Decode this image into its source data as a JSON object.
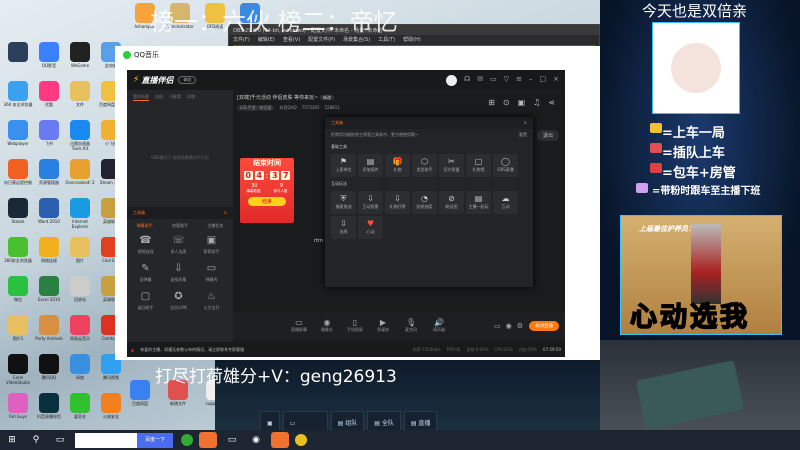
{
  "desktop": {
    "icons": [
      [
        "Ashampoo",
        "#f7a23a"
      ],
      [
        "Administrator",
        "#d7b56a"
      ],
      [
        "OFD阅读",
        "#f0c040"
      ],
      [
        "OFD",
        "#3a8be0"
      ],
      [
        "",
        "#2c3f5a"
      ],
      [
        "QQ影音",
        "#3a80ff"
      ],
      [
        "WeGame",
        "#222"
      ],
      [
        "此电脑",
        "#5aa0e8"
      ],
      [
        "360 安全浏览器",
        "#3aa0f0"
      ],
      [
        "优酷",
        "#ff3a80"
      ],
      [
        "文件",
        "#e8c060"
      ],
      [
        "百度网盘文件",
        "#f0c040"
      ],
      [
        "Webplayer",
        "#3a90f0"
      ],
      [
        "飞书",
        "#6a7af0"
      ],
      [
        "迅雷加速器 Tools Kit",
        "#1a8af0"
      ],
      [
        "小飞鼠",
        "#f0b030"
      ],
      [
        "向日葵远程控制",
        "#f06020"
      ],
      [
        "资源管理器",
        "#2a80e0"
      ],
      [
        "Overcooked! 2",
        "#e8a030"
      ],
      [
        "Steam 游戏",
        "#223"
      ],
      [
        "Steam",
        "#1b2838"
      ],
      [
        "Word 2010",
        "#2b5fb0"
      ],
      [
        "Internet Explorer",
        "#1a9ae0"
      ],
      [
        "英雄联盟",
        "#c8a040"
      ],
      [
        "360安全浏览器",
        "#4ac030"
      ],
      [
        "网络连接",
        "#f0b020"
      ],
      [
        "图片",
        "#e8c060"
      ],
      [
        "Cool Edit",
        "#e04020"
      ],
      [
        "微信",
        "#2ac040"
      ],
      [
        "Excel 2010",
        "#2a8040"
      ],
      [
        "回收站",
        "#ccc"
      ],
      [
        "英雄联盟",
        "#c8a040"
      ],
      [
        "图片1",
        "#e8c060"
      ],
      [
        "Party Animals",
        "#d89040"
      ],
      [
        "网易云音乐",
        "#f04060"
      ],
      [
        "Camtasia",
        "#e03020"
      ],
      [
        "Corel VideoStudio",
        "#111"
      ],
      [
        "腾讯QQ",
        "#111"
      ],
      [
        "网络",
        "#3a90e0"
      ],
      [
        "腾讯视频",
        "#30a0f0"
      ],
      [
        "Fall Guys",
        "#e060c0"
      ],
      [
        "抖音直播伴侣",
        "#0a3040"
      ],
      [
        "爱奇艺",
        "#30c030"
      ],
      [
        "火绒安全",
        "#f08020"
      ]
    ],
    "extra_icons": [
      [
        "百度网盘",
        "#3a80f0"
      ],
      [
        "新建文件",
        "#e05050"
      ],
      [
        "sugarsimu",
        "#eee"
      ]
    ]
  },
  "overlay": {
    "top_banner": "榜一：六伙  榜二：帝忆",
    "top_right": "今天也是双倍亲",
    "rules": [
      "=上车一局",
      "=插队上车",
      "=包车+房管",
      "=带粉时跟车至主播下班"
    ],
    "supporter_title": "上届最佳护养员：",
    "slogan": "心动选我",
    "contact": "打尽打荷雄分+V：geng26913",
    "game_buttons": [
      "",
      "",
      "组队",
      "全队",
      "直播"
    ]
  },
  "obs": {
    "title": "OBS 29.0.0 (64-bit, windows) - 配置文件: 未命名 - 场景: 未命名",
    "menu": [
      "文件(F)",
      "编辑(E)",
      "查看(V)",
      "配置文件(P)",
      "场景集合(S)",
      "工具(T)",
      "帮助(H)"
    ]
  },
  "qqmusic": {
    "title": "QQ音乐"
  },
  "app": {
    "logo": "直播伴侣",
    "badge": "体验",
    "scene_tabs": [
      "我的场景",
      "自由",
      "可能我",
      "玫瑰"
    ],
    "obs_notice": "OBS模式下 伴侣场景素材不可用",
    "toolbox_title": "工具箱",
    "toolbox_tabs": [
      "弹幕助手",
      "房管助手",
      "主播任务"
    ],
    "left_tools": [
      [
        "视频连线",
        "☎"
      ],
      [
        "多人连麦",
        "☏"
      ],
      [
        "帮帮助手",
        "▣"
      ],
      [
        "设弹幕",
        "✎"
      ],
      [
        "虚拟形象",
        "⇩"
      ],
      [
        "弹幕秀",
        "▭"
      ],
      [
        "姿回助手",
        "▢"
      ],
      [
        "全民乐PK",
        "✪"
      ],
      [
        "火力全开",
        "♨"
      ]
    ],
    "stream_title": "[双端]千元活动 伴侣皮肤 等你来玩~",
    "edit_tag": "修改",
    "category": "LOL手游 - 峡谷面",
    "account": "抖音QUQ",
    "room_id": "7573365",
    "popularity": "528811",
    "exit_label": "退出",
    "rtm_label": "rtm",
    "countdown": {
      "title": "结束时间",
      "digits": [
        "0",
        "4",
        "3",
        "7"
      ],
      "stat1": "30",
      "stat1_label": "弹幕数据",
      "stat2": "9",
      "stat2_label": "参与人数",
      "end_btn": "结束"
    },
    "popup": {
      "title": "工具箱",
      "desc": "把常用功能拖到主界面工具条中，更方便使用哦~",
      "reset": "重置",
      "basic_title": "基础工具",
      "basic": [
        [
          "上麦带位",
          "⚑"
        ],
        [
          "添加插件",
          "▤"
        ],
        [
          "礼物",
          "🎁"
        ],
        [
          "发货助手",
          "⬡"
        ],
        [
          "官方帮盟",
          "✂"
        ],
        [
          "礼物墙",
          "▢"
        ],
        [
          "OBS直播",
          "◯"
        ]
      ],
      "interact_title": "互动玩法",
      "interact": [
        [
          "福星热战",
          "⛨"
        ],
        [
          "互动投票",
          "⇩"
        ],
        [
          "礼物打榜",
          "⇩"
        ],
        [
          "贴纸抽奖",
          "◔"
        ],
        [
          "粉丝团",
          "⊘"
        ],
        [
          "主播一起玩",
          "▤"
        ],
        [
          "互动",
          "☁"
        ],
        [
          "连线",
          "⇩"
        ],
        [
          "心动",
          "♥"
        ]
      ]
    },
    "bottom_tools": [
      [
        "直播屏幕",
        "▭"
      ],
      [
        "摄像头",
        "◉"
      ],
      [
        "手机投屏",
        "▯"
      ],
      [
        "多媒体",
        "▶"
      ],
      [
        "麦克风",
        "🎙"
      ],
      [
        "扬声器",
        "🔊"
      ]
    ],
    "close_live": "关闭直播",
    "status_notice": "亲爱的主播，如遇无参数公布的情况，请立即联系专职客服",
    "status_stats": [
      "码率:7503kb/s",
      "FPS:60",
      "丢帧:0.00%",
      "CPU:32%",
      "内存:59%"
    ],
    "timer": "07:59:50"
  },
  "taskbar": {
    "search_btn": "百度一下"
  },
  "colors": {
    "accent": "#ff6a1a",
    "app_bg": "#1e1f22"
  }
}
